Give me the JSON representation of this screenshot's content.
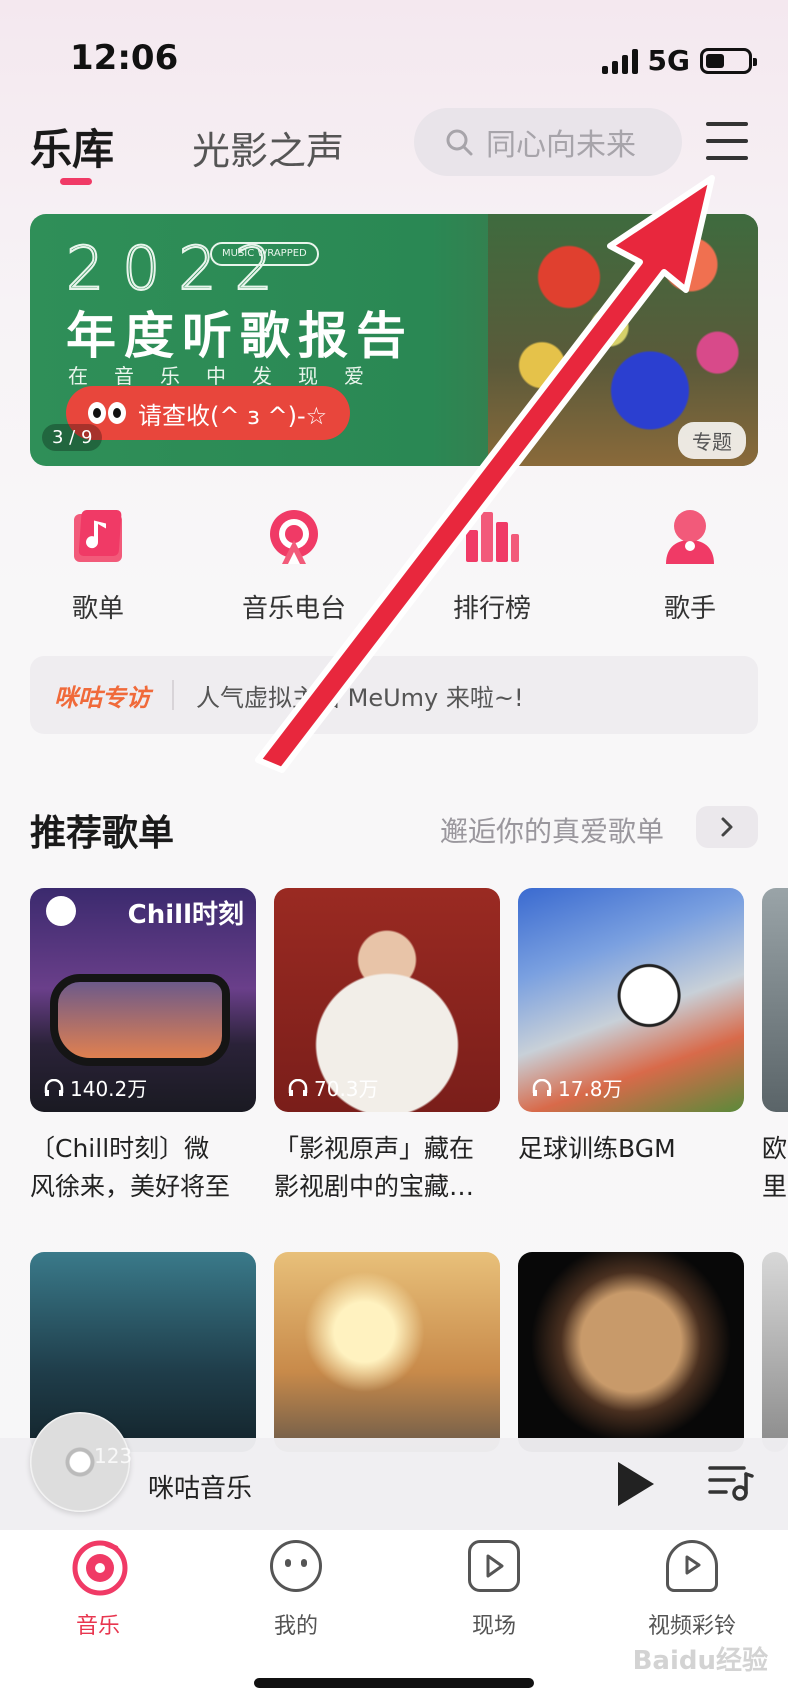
{
  "status_bar": {
    "time": "12:06",
    "network": "5G"
  },
  "header": {
    "active_tab": "乐库",
    "second_tab": "光影之声",
    "search_placeholder": "同心向未来"
  },
  "banner": {
    "year": "2022",
    "badge": "MUSIC WRAPPED",
    "title": "年度听歌报告",
    "subtitle": "在音乐中发现爱",
    "cta": "请查收(^ з ^)-☆",
    "page_indicator": "3 / 9",
    "tag": "专题"
  },
  "shortcuts": [
    {
      "label": "歌单",
      "icon": "playlist-icon"
    },
    {
      "label": "音乐电台",
      "icon": "radio-icon"
    },
    {
      "label": "排行榜",
      "icon": "chart-bars-icon"
    },
    {
      "label": "歌手",
      "icon": "singer-icon"
    }
  ],
  "notice": {
    "tag": "咪咕专访",
    "text": "人气虚拟主播 MeUmy 来啦~!"
  },
  "recommended": {
    "title": "推荐歌单",
    "subtitle": "邂逅你的真爱歌单",
    "cards": [
      {
        "cover_label": "Chill时刻",
        "plays": "140.2万",
        "title_line1": "〔Chill时刻〕微",
        "title_line2": "风徐来，美好将至"
      },
      {
        "plays": "70.3万",
        "title_line1": "「影视原声」藏在",
        "title_line2": "影视剧中的宝藏…"
      },
      {
        "plays": "17.8万",
        "title_line1": "足球训练BGM",
        "title_line2": ""
      },
      {
        "title_line1": "欧",
        "title_line2": "里"
      }
    ]
  },
  "player": {
    "title": "咪咕音乐",
    "disc_overlay": "123"
  },
  "bottom_nav": [
    {
      "label": "音乐",
      "icon": "music-disc-icon",
      "active": true
    },
    {
      "label": "我的",
      "icon": "profile-face-icon",
      "active": false
    },
    {
      "label": "现场",
      "icon": "live-play-icon",
      "active": false
    },
    {
      "label": "视频彩铃",
      "icon": "video-bell-icon",
      "active": false
    }
  ],
  "watermark": "Baidu经验",
  "colors": {
    "accent": "#f03a66",
    "annotation_arrow": "#e8273d",
    "banner_green": "#2f8f58"
  }
}
